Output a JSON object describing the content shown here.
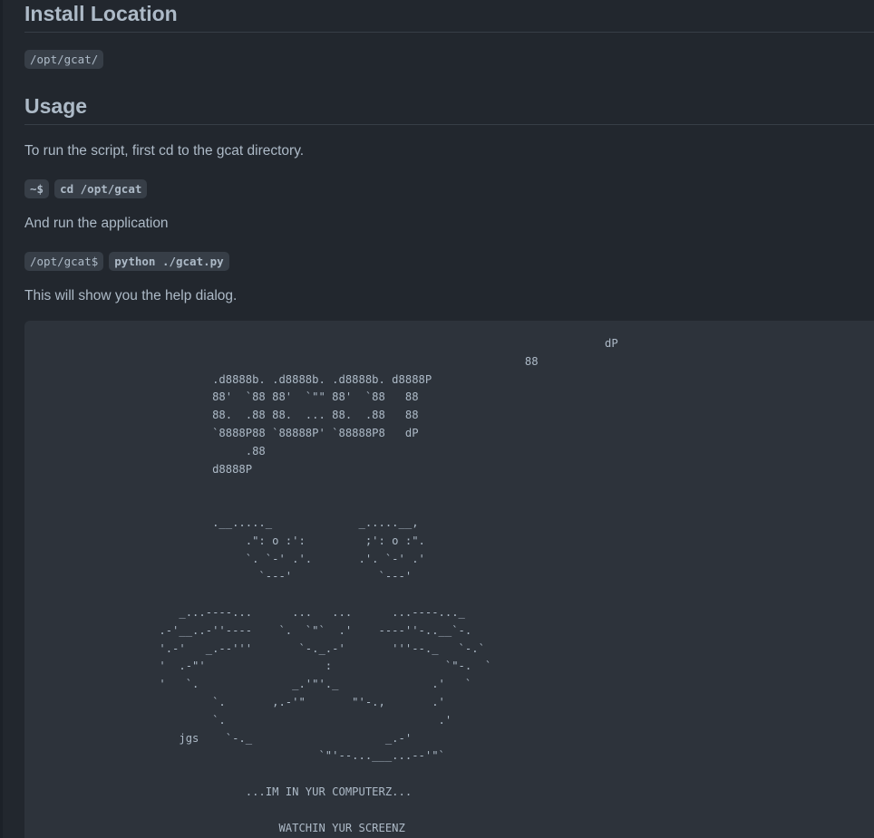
{
  "sections": {
    "install": {
      "heading": "Install Location",
      "path": "/opt/gcat/"
    },
    "usage": {
      "heading": "Usage",
      "step1_text": "To run the script, first cd to the gcat directory.",
      "step1_prompt": "~$",
      "step1_command": "cd /opt/gcat",
      "step2_text": "And run the application",
      "step2_prompt": "/opt/gcat$",
      "step2_command": "python ./gcat.py",
      "step3_text": "This will show you the help dialog."
    }
  },
  "help_output": {
    "ascii_art": "                                                                             dP\n                                                                 88\n                  .d8888b. .d8888b. .d8888b. d8888P\n                  88'  `88 88'  `\"\" 88'  `88   88\n                  88.  .88 88.  ... 88.  .88   88\n                  `8888P88 `88888P' `88888P8   dP\n                       .88\n                  d8888P\n\n\n                  .__....._             _.....__,\n                       .\": o :':         ;': o :\".\n                       `. `-' .'.       .'. `-' .'\n                         `---'             `---'\n\n             _...----...      ...   ...      ...----..._\n          .-'__..-''----    `.  `\"`  .'    ----''-..__`-.\n          '.-'   _.--'''       `-._.-'       '''--._   `-.`\n          '  .-\"'                  :                 `\"-.  `\n          '   `.              _.'\"'._              .'   `\n                  `.       ,.-'\"       \"'-.,       .'\n                  `.                                .'\n             jgs    `-._                    _.-'\n                                  `\"'--...___...--'\"`\n\n                       ...IM IN YUR COMPUTERZ...\n\n                            WATCHIN YUR SCREENZ"
  }
}
